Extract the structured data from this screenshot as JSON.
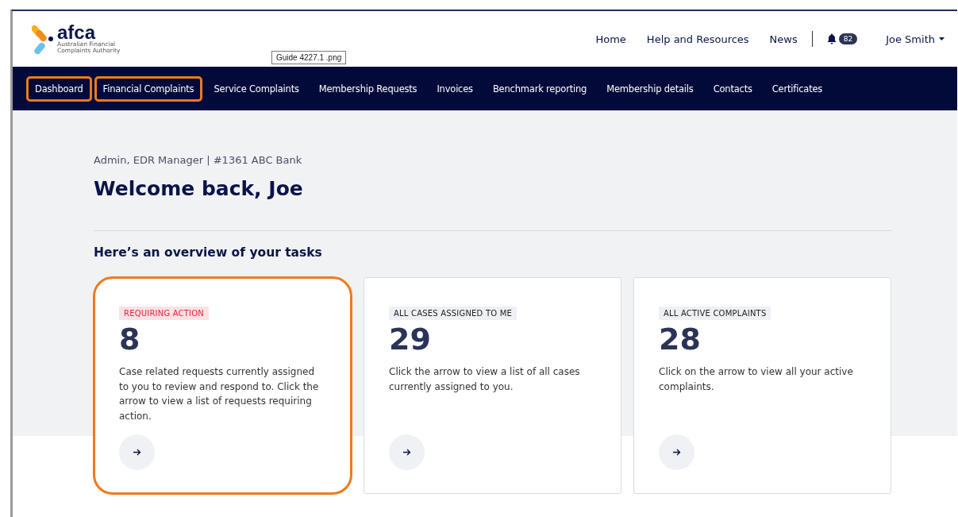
{
  "logo": {
    "name": "afca",
    "tagline": "Australian Financial Complaints Authority"
  },
  "tooltip": "Guide 4227.1 .png",
  "top_links": [
    "Home",
    "Help and Resources",
    "News"
  ],
  "notifications": {
    "count": "82"
  },
  "user": {
    "name": "Joe Smith"
  },
  "nav": [
    {
      "label": "Dashboard",
      "highlighted": true
    },
    {
      "label": "Financial Complaints",
      "highlighted": true
    },
    {
      "label": "Service Complaints",
      "highlighted": false
    },
    {
      "label": "Membership Requests",
      "highlighted": false
    },
    {
      "label": "Invoices",
      "highlighted": false
    },
    {
      "label": "Benchmark reporting",
      "highlighted": false
    },
    {
      "label": "Membership details",
      "highlighted": false
    },
    {
      "label": "Contacts",
      "highlighted": false
    },
    {
      "label": "Certificates",
      "highlighted": false
    }
  ],
  "role": "Admin, EDR Manager | #1361 ABC Bank",
  "welcome": "Welcome back, Joe",
  "overview_title": "Here’s an overview of your tasks",
  "cards": [
    {
      "tag": "REQUIRING ACTION",
      "kind": "alert",
      "count": "8",
      "description": "Case related requests currently assigned to you to review and respond to. Click the arrow to view a list of requests requiring action.",
      "highlighted": true
    },
    {
      "tag": "ALL CASES ASSIGNED TO ME",
      "kind": "neutral",
      "count": "29",
      "description": "Click the arrow to view a list of all cases currently assigned to you.",
      "highlighted": false
    },
    {
      "tag": "ALL ACTIVE COMPLAINTS",
      "kind": "neutral",
      "count": "28",
      "description": "Click on the arrow to view all your active complaints.",
      "highlighted": false
    }
  ]
}
